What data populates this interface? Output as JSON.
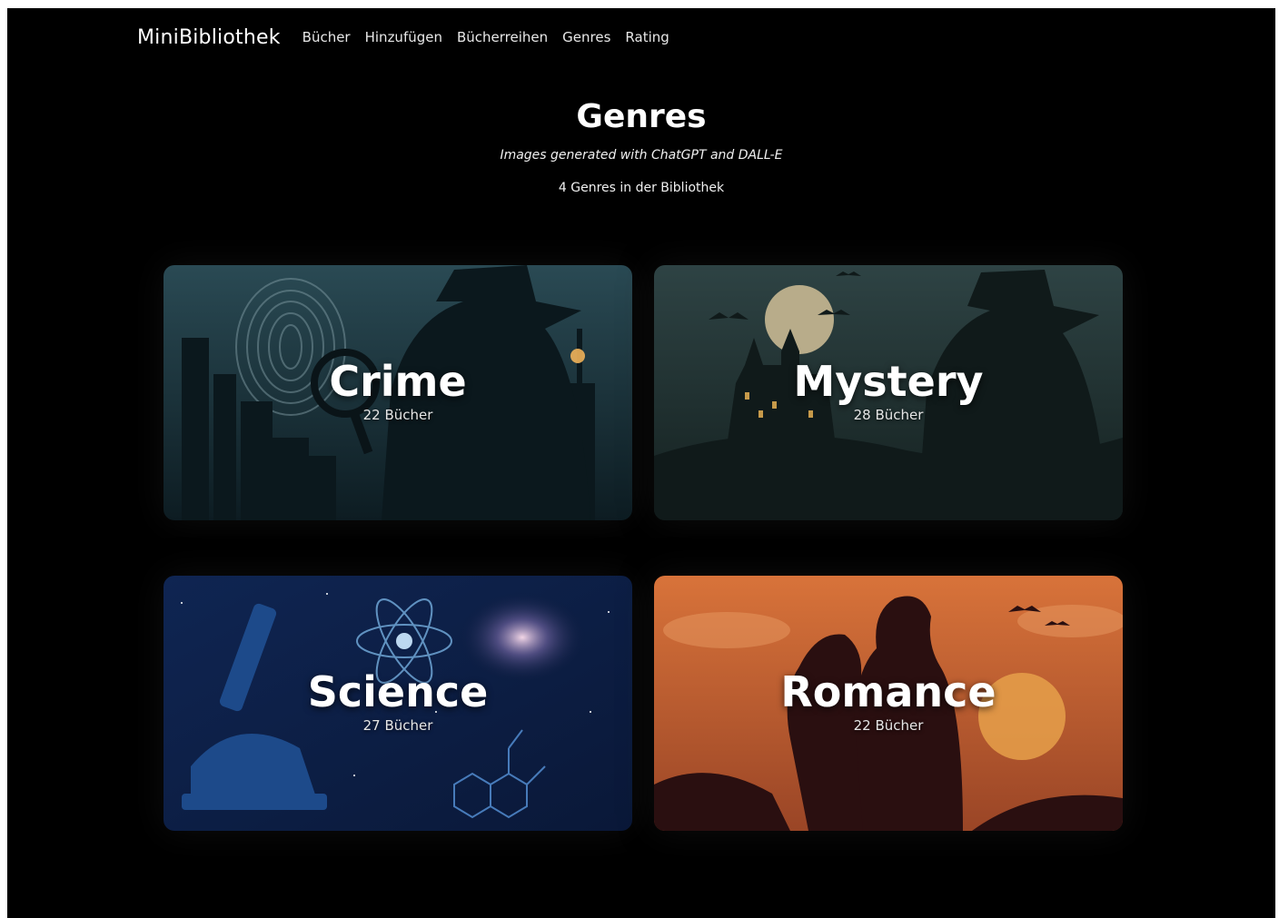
{
  "navbar": {
    "brand": "MiniBibliothek",
    "links": [
      "Bücher",
      "Hinzufügen",
      "Bücherreihen",
      "Genres",
      "Rating"
    ]
  },
  "page": {
    "title": "Genres",
    "subtitle": "Images generated with ChatGPT and DALL-E",
    "count": "4 Genres in der Bibliothek"
  },
  "genres": [
    {
      "name": "Crime",
      "books": "22 Bücher",
      "theme_color": "#1f3a44"
    },
    {
      "name": "Mystery",
      "books": "28 Bücher",
      "theme_color": "#2a3d3d"
    },
    {
      "name": "Science",
      "books": "27 Bücher",
      "theme_color": "#142a5c"
    },
    {
      "name": "Romance",
      "books": "22 Bücher",
      "theme_color": "#c2622e"
    }
  ]
}
